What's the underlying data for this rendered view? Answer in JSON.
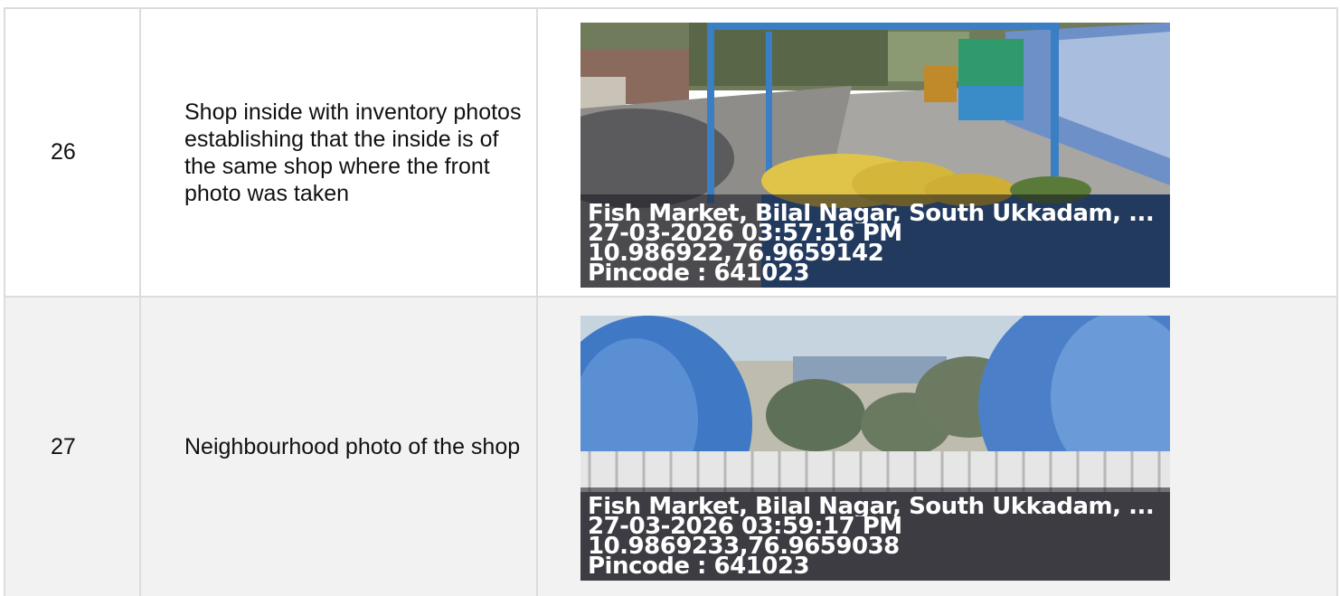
{
  "rows": [
    {
      "number": "26",
      "description": "Shop inside with inventory photos establishing that the inside is of the same shop where the front photo was taken",
      "photo": {
        "location": "Fish Market, Bilal Nagar, South Ukkadam, ...",
        "datetime": "27-03-2026 03:57:16 PM",
        "coords": "10.986922,76.9659142",
        "pincode": "Pincode : 641023"
      }
    },
    {
      "number": "27",
      "description": "Neighbourhood photo of the shop",
      "photo": {
        "location": "Fish Market, Bilal Nagar, South Ukkadam, ...",
        "datetime": "27-03-2026 03:59:17 PM",
        "coords": "10.9869233,76.9659038",
        "pincode": "Pincode : 641023"
      }
    }
  ]
}
